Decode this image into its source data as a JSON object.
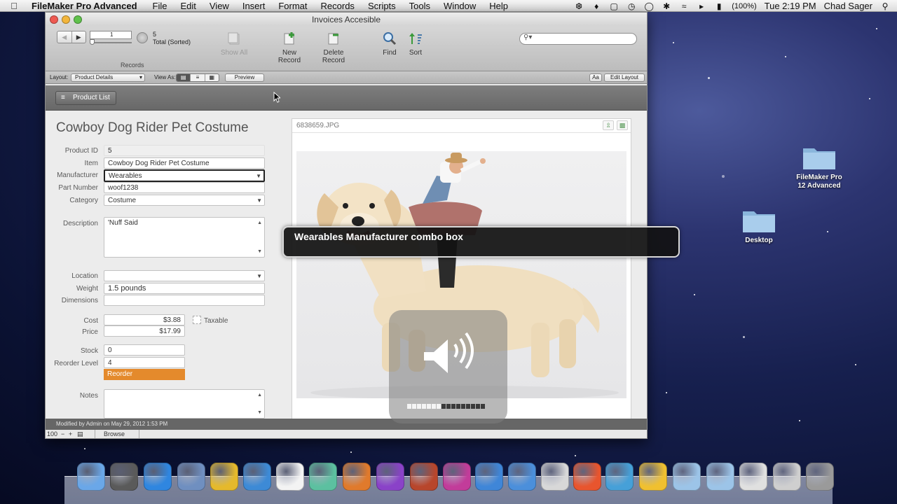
{
  "menubar": {
    "app_name": "FileMaker Pro Advanced",
    "menus": [
      "File",
      "Edit",
      "View",
      "Insert",
      "Format",
      "Records",
      "Scripts",
      "Tools",
      "Window",
      "Help"
    ],
    "battery": "(100%)",
    "clock": "Tue 2:19 PM",
    "user": "Chad Sager"
  },
  "window": {
    "title": "Invoices Accesible"
  },
  "toolbar": {
    "record_number": "1",
    "total_count": "5",
    "total_label": "Total (Sorted)",
    "records_label": "Records",
    "show_all": "Show All",
    "new_record": "New Record",
    "delete_record": "Delete Record",
    "find": "Find",
    "sort": "Sort",
    "search_placeholder": ""
  },
  "layoutbar": {
    "layout_label": "Layout:",
    "layout_value": "Product Details",
    "view_as_label": "View As:",
    "preview": "Preview",
    "aa_icon": "Aa",
    "edit_layout": "Edit Layout"
  },
  "nav": {
    "product_list": "Product List"
  },
  "record": {
    "title": "Cowboy Dog Rider Pet Costume",
    "fields": {
      "product_id": {
        "label": "Product ID",
        "value": "5"
      },
      "item": {
        "label": "Item",
        "value": "Cowboy Dog Rider Pet Costume"
      },
      "manufacturer": {
        "label": "Manufacturer",
        "value": "Wearables"
      },
      "part_number": {
        "label": "Part Number",
        "value": "woof1238"
      },
      "category": {
        "label": "Category",
        "value": "Costume"
      },
      "description": {
        "label": "Description",
        "value": "'Nuff Said"
      },
      "location": {
        "label": "Location",
        "value": ""
      },
      "weight": {
        "label": "Weight",
        "value": "1.5 pounds"
      },
      "dimensions": {
        "label": "Dimensions",
        "value": ""
      },
      "cost": {
        "label": "Cost",
        "value": "$3.88"
      },
      "taxable": {
        "label": "Taxable"
      },
      "price": {
        "label": "Price",
        "value": "$17.99"
      },
      "stock": {
        "label": "Stock",
        "value": "0"
      },
      "reorder_level": {
        "label": "Reorder Level",
        "value": "4"
      },
      "reorder_flag": "Reorder",
      "notes": {
        "label": "Notes",
        "value": ""
      }
    },
    "image_filename": "6838659.JPG"
  },
  "status": {
    "modified": "Modified by Admin on May 29, 2012 1:53 PM",
    "zoom": "100",
    "mode": "Browse"
  },
  "voiceover": {
    "caption": "Wearables Manufacturer combo box",
    "volume_segments_total": 16,
    "volume_segments_filled": 7
  },
  "desktop": {
    "icons": [
      {
        "label": "FileMaker Pro\n12 Advanced"
      },
      {
        "label": "Desktop"
      }
    ]
  },
  "dock": {
    "items": [
      "finder-icon",
      "launchpad-icon",
      "app-store-icon",
      "mail-stamp-icon",
      "ring-app-icon",
      "safari-icon",
      "calendar-icon",
      "network-icon",
      "grid-app-icon",
      "omnifocus-icon",
      "instruments-icon",
      "pink-app-icon",
      "xcode-icon",
      "developer-icon",
      "blank-doc-icon",
      "presentation-icon",
      "monitor-app-icon",
      "flower-app-icon",
      "folder-icon",
      "folder-icon-2",
      "documents-stack-icon",
      "window-stack-icon",
      "trash-icon"
    ]
  },
  "colors": {
    "reorder_orange": "#e48a2c",
    "desktop_blue": "#17204f"
  }
}
